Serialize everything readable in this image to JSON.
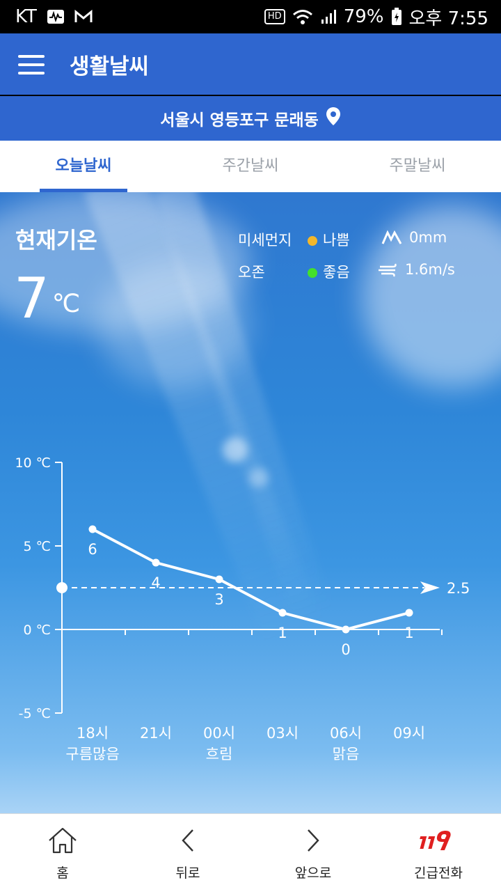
{
  "status_bar": {
    "carrier": "KT",
    "battery": "79%",
    "time": "오후 7:55",
    "hd_badge": "HD"
  },
  "app": {
    "title": "생활날씨"
  },
  "location": {
    "name": "서울시 영등포구 문래동"
  },
  "tabs": [
    {
      "label": "오늘날씨",
      "active": true
    },
    {
      "label": "주간날씨",
      "active": false
    },
    {
      "label": "주말날씨",
      "active": false
    }
  ],
  "current": {
    "label": "현재기온",
    "temp": "7",
    "unit": "℃",
    "fine_dust_label": "미세먼지",
    "fine_dust_value": "나쁨",
    "fine_dust_color": "#f3b72b",
    "ozone_label": "오존",
    "ozone_value": "좋음",
    "ozone_color": "#44e02c",
    "rain": "0mm",
    "wind": "1.6m/s"
  },
  "chart_data": {
    "type": "line",
    "x": [
      "18시",
      "21시",
      "00시",
      "03시",
      "06시",
      "09시"
    ],
    "values": [
      6,
      4,
      3,
      1,
      0,
      1
    ],
    "conditions": [
      "구름많음",
      "",
      "흐림",
      "",
      "맑음",
      ""
    ],
    "y_ticks": [
      "10 ℃",
      "5 ℃",
      "0 ℃",
      "-5 ℃"
    ],
    "ylim": [
      -5,
      10
    ],
    "reference_value": 2.5,
    "reference_label": "2.5"
  },
  "bottom_nav": [
    {
      "label": "홈",
      "icon": "home-icon"
    },
    {
      "label": "뒤로",
      "icon": "chevron-left-icon"
    },
    {
      "label": "앞으로",
      "icon": "chevron-right-icon"
    },
    {
      "label": "긴급전화",
      "icon": "emergency-119-icon"
    }
  ]
}
